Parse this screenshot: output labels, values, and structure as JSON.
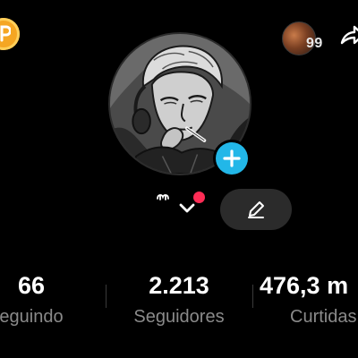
{
  "header": {
    "coin_icon": "coin-icon",
    "story_count": "99",
    "share_icon": "share-icon"
  },
  "profile": {
    "avatar_icon": "profile-avatar",
    "add_icon": "plus-icon",
    "edit_icon": "pencil-icon",
    "notification_color": "#fe2c55",
    "accent_color": "#22b7e8"
  },
  "stats": [
    {
      "value": "66",
      "label": "eguindo"
    },
    {
      "value": "2.213",
      "label": "Seguidores"
    },
    {
      "value": "476,3 m",
      "label": "Curtidas"
    }
  ]
}
